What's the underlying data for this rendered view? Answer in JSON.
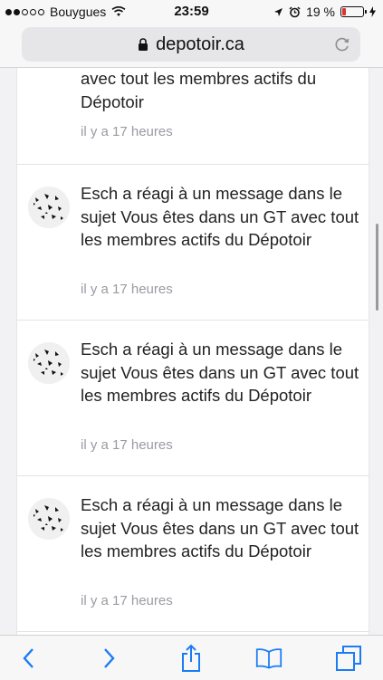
{
  "status": {
    "carrier": "Bouygues",
    "time": "23:59",
    "battery": "19 %",
    "battery_level": 0.19
  },
  "browser": {
    "url": "depotoir.ca"
  },
  "notifications": [
    {
      "partial": true,
      "visible_text": "avec tout les membres actifs du Dépotoir",
      "time": "il y a 17 heures"
    },
    {
      "text": "Esch a réagi à un message dans le sujet Vous êtes dans un GT avec tout les membres actifs du Dépotoir",
      "time": "il y a 17 heures"
    },
    {
      "text": "Esch a réagi à un message dans le sujet Vous êtes dans un GT avec tout les membres actifs du Dépotoir",
      "time": "il y a 17 heures"
    },
    {
      "text": "Esch a réagi à un message dans le sujet Vous êtes dans un GT avec tout les membres actifs du Dépotoir",
      "time": "il y a 17 heures"
    }
  ],
  "colors": {
    "accent": "#1a7cf5",
    "battery_low": "#e0312c"
  }
}
